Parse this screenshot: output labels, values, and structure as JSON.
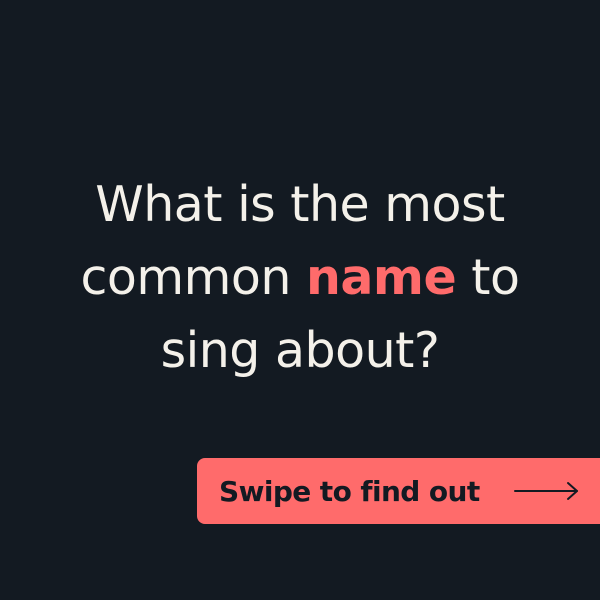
{
  "headline": {
    "line1": "What is the most",
    "line2_before": "common ",
    "line2_highlight": "name",
    "line2_after": " to",
    "line3": "sing about?"
  },
  "cta": {
    "label": "Swipe to find out",
    "icon": "arrow-right-icon"
  },
  "colors": {
    "background": "#131a22",
    "text": "#f4f1ea",
    "accent": "#ff6b6b"
  }
}
